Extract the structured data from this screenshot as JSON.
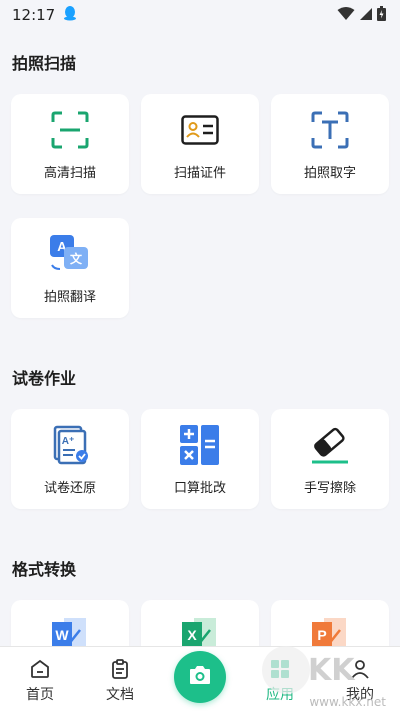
{
  "status_bar": {
    "time": "12:17"
  },
  "sections": [
    {
      "title": "拍照扫描"
    },
    {
      "title": "试卷作业"
    },
    {
      "title": "格式转换"
    }
  ],
  "cards": {
    "scan_hd": {
      "label": "高清扫描",
      "icon": "scan-frame-icon"
    },
    "scan_id": {
      "label": "扫描证件",
      "icon": "id-card-icon"
    },
    "photo_text": {
      "label": "拍照取字",
      "icon": "text-recognition-icon"
    },
    "photo_translate": {
      "label": "拍照翻译",
      "icon": "translate-icon"
    },
    "paper_restore": {
      "label": "试卷还原",
      "icon": "paper-restore-icon"
    },
    "oral_check": {
      "label": "口算批改",
      "icon": "calculator-icon"
    },
    "erase_handwriting": {
      "label": "手写擦除",
      "icon": "eraser-icon"
    },
    "to_word": {
      "label": "",
      "icon": "word-icon"
    },
    "to_excel": {
      "label": "",
      "icon": "excel-icon"
    },
    "to_ppt": {
      "label": "",
      "icon": "ppt-icon"
    }
  },
  "bottom_nav": {
    "home": "首页",
    "docs": "文档",
    "apps": "应用",
    "mine": "我的"
  },
  "watermark": {
    "text": "www.kkx.net"
  },
  "colors": {
    "brand_green": "#1dbf8a",
    "icon_blue": "#3b7de9",
    "icon_green": "#1aa56f",
    "icon_orange": "#f07a3a",
    "background": "#f4f5f9"
  }
}
